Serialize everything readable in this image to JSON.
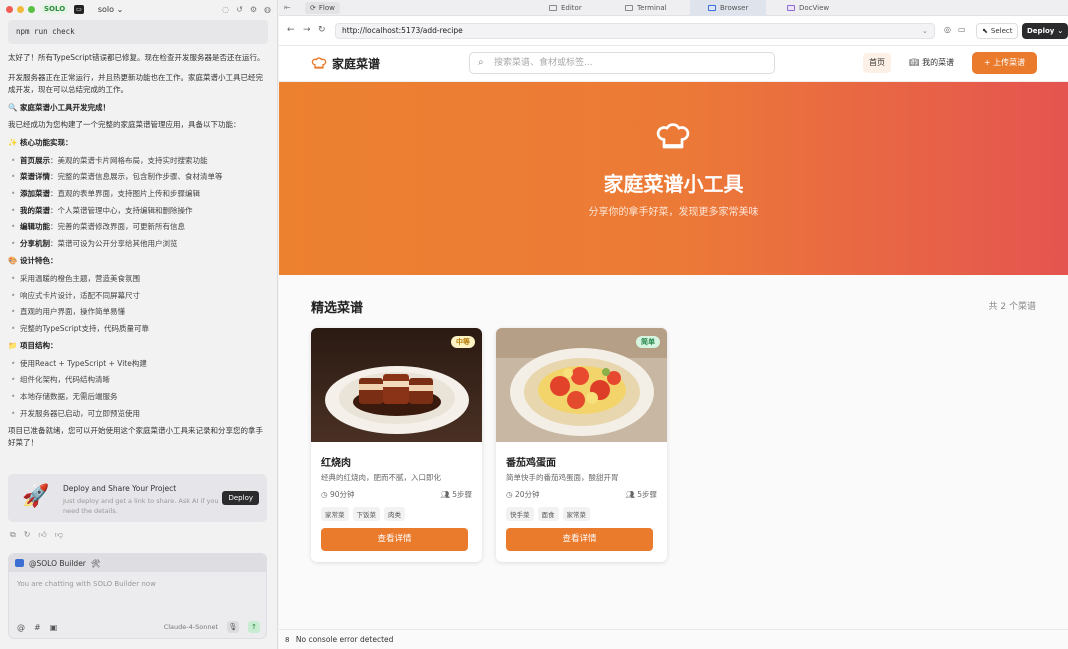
{
  "app": {
    "badge": "SOLO",
    "project": "solo"
  },
  "chat": {
    "code_snippet": "npm run check",
    "para1": "太好了！所有TypeScript错误都已修复。现在检查开发服务器是否还在运行。",
    "para2": "开发服务器正在正常运行，并且热更新功能也在工作。家庭菜谱小工具已经完成开发，现在可以总结完成的工作。",
    "done_heading": "家庭菜谱小工具开发完成！",
    "intro": "我已经成功为您构建了一个完整的家庭菜谱管理应用，具备以下功能：",
    "core_title": "核心功能实现：",
    "core_items": [
      {
        "label": "首页展示",
        "text": "：美观的菜谱卡片网格布局，支持实时搜索功能"
      },
      {
        "label": "菜谱详情",
        "text": "：完整的菜谱信息展示，包含制作步骤、食材清单等"
      },
      {
        "label": "添加菜谱",
        "text": "：直观的表单界面，支持图片上传和步骤编辑"
      },
      {
        "label": "我的菜谱",
        "text": "：个人菜谱管理中心，支持编辑和删除操作"
      },
      {
        "label": "编辑功能",
        "text": "：完善的菜谱修改界面，可更新所有信息"
      },
      {
        "label": "分享机制",
        "text": "：菜谱可设为公开分享给其他用户浏览"
      }
    ],
    "design_title": "设计特色：",
    "design_items": [
      "采用温暖的橙色主题，营造美食氛围",
      "响应式卡片设计，适配不同屏幕尺寸",
      "直观的用户界面，操作简单易懂",
      "完整的TypeScript支持，代码质量可靠"
    ],
    "struct_title": "项目结构：",
    "struct_items": [
      "使用React + TypeScript + Vite构建",
      "组件化架构，代码结构清晰",
      "本地存储数据，无需后端服务",
      "开发服务器已启动，可立即预览使用"
    ],
    "closing": "项目已准备就绪，您可以开始使用这个家庭菜谱小工具来记录和分享您的拿手好菜了！",
    "deploy_title": "Deploy and Share Your Project",
    "deploy_desc": "Just deploy and get a link to share. Ask AI if you need the details.",
    "deploy_btn": "Deploy",
    "builder_label": "@SOLO Builder",
    "input_placeholder": "You are chatting with SOLO Builder now",
    "model": "Claude-4-Sonnet"
  },
  "tabs": {
    "flow": "Flow",
    "editor": "Editor",
    "terminal": "Terminal",
    "browser": "Browser",
    "docview": "DocView"
  },
  "browser": {
    "url": "http://localhost:5173/add-recipe",
    "select": "Select",
    "deploy": "Deploy"
  },
  "site": {
    "logo": "家庭菜谱",
    "search_placeholder": "搜索菜谱、食材或标签...",
    "nav_home": "首页",
    "nav_my": "我的菜谱",
    "upload": "+ 上传菜谱",
    "hero_title": "家庭菜谱小工具",
    "hero_subtitle": "分享你的拿手好菜，发现更多家常美味",
    "section_title": "精选菜谱",
    "count": "共 2 个菜谱",
    "recipes": [
      {
        "name": "红烧肉",
        "difficulty": "中等",
        "desc": "经典的红烧肉，肥而不腻，入口即化",
        "time": "90分钟",
        "steps": "5步骤",
        "tags": [
          "家常菜",
          "下饭菜",
          "肉类"
        ],
        "view": "查看详情"
      },
      {
        "name": "番茄鸡蛋面",
        "difficulty": "简单",
        "desc": "简单快手的番茄鸡蛋面，酸甜开胃",
        "time": "20分钟",
        "steps": "5步骤",
        "tags": [
          "快手菜",
          "面食",
          "家常菜"
        ],
        "view": "查看详情"
      }
    ]
  },
  "console": {
    "count": "8",
    "text": "No console error detected"
  },
  "colors": {
    "accent": "#ea7a2c",
    "hero_end": "#e55450"
  }
}
